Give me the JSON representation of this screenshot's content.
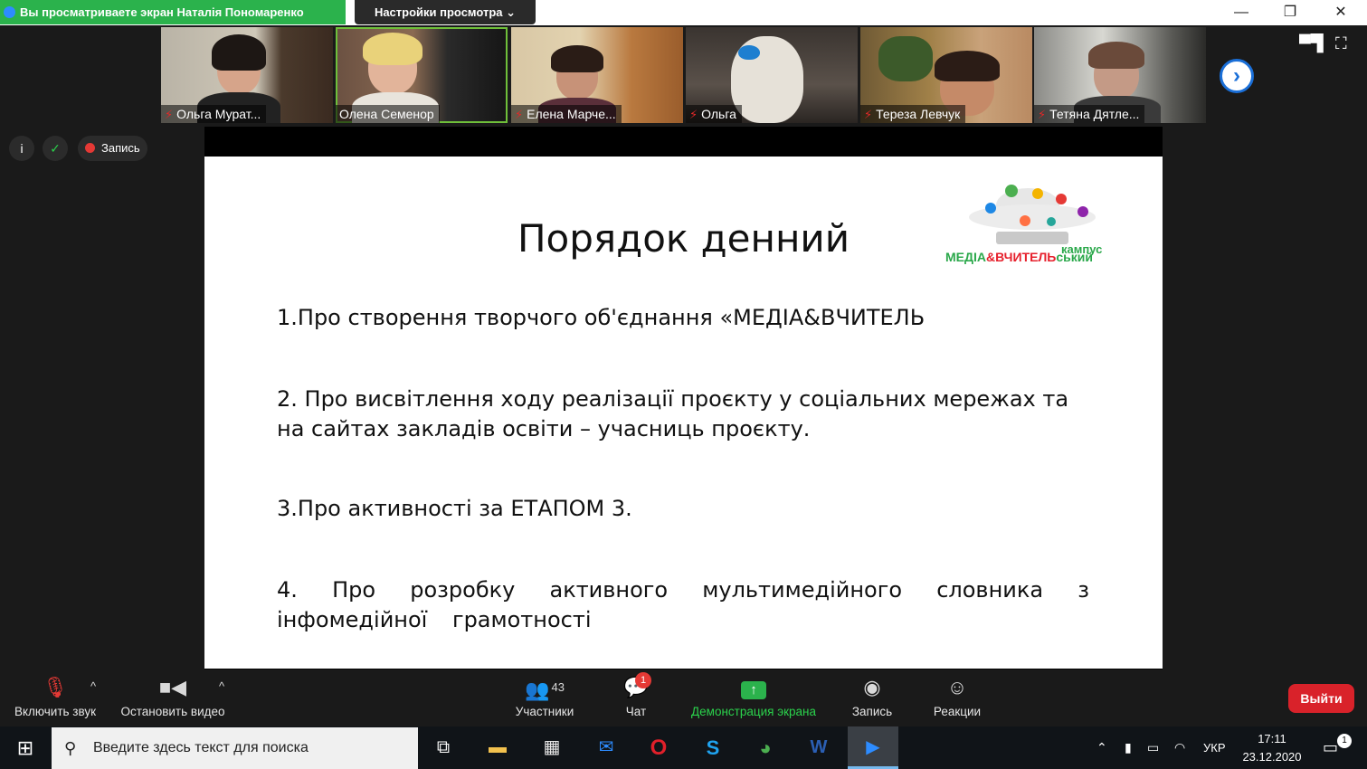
{
  "top_bar": {
    "share_banner": "Вы просматриваете экран Наталія Пономаренко",
    "view_options": "Настройки просмотра ⌄",
    "minimize": "—",
    "restore": "❐",
    "close": "✕"
  },
  "gallery": {
    "participants": [
      {
        "name": "Ольга Мурат..."
      },
      {
        "name": "Олена Семенор"
      },
      {
        "name": "Елена Марче..."
      },
      {
        "name": "Ольга"
      },
      {
        "name": "Тереза Левчук"
      },
      {
        "name": "Тетяна Дятле..."
      }
    ],
    "next_page": "›"
  },
  "meeting_info": {
    "info_icon": "i",
    "shield_icon": "✓",
    "recording_label": "Запись"
  },
  "slide": {
    "title": "Порядок денний",
    "logo_main_a": "МЕДІА",
    "logo_amp": "&",
    "logo_main_b": "ВЧИТЕЛЬ",
    "logo_suffix": "ський",
    "logo_kampus": "кампус",
    "items": [
      "1.Про створення  творчого об'єднання  «МЕДІА&ВЧИТЕЛЬ",
      "2. Про висвітлення ходу реалізації проєкту у соціальних мережах та на сайтах закладів освіти – учасниць проєкту.",
      "3.Про активності за  ЕТАПОМ 3.",
      "4. Про розробку активного мультимедійного словника з інфомедійної грамотності"
    ]
  },
  "toolbar": {
    "audio": "Включить звук",
    "video": "Остановить видео",
    "participants": "Участники",
    "participants_count": "43",
    "chat": "Чат",
    "chat_badge": "1",
    "share_screen": "Демонстрация экрана",
    "record": "Запись",
    "reactions": "Реакции",
    "leave": "Выйти",
    "caret": "^"
  },
  "taskbar": {
    "search_placeholder": "Введите здесь текст для поиска",
    "language": "УКР",
    "time": "17:11",
    "date": "23.12.2020",
    "notifications": "1"
  },
  "colors": {
    "banner_green": "#2bb24c",
    "leave_red": "#d9222a",
    "logo_green": "#2aa84a",
    "logo_red": "#e6202c",
    "next_blue": "#1a6fd8"
  }
}
